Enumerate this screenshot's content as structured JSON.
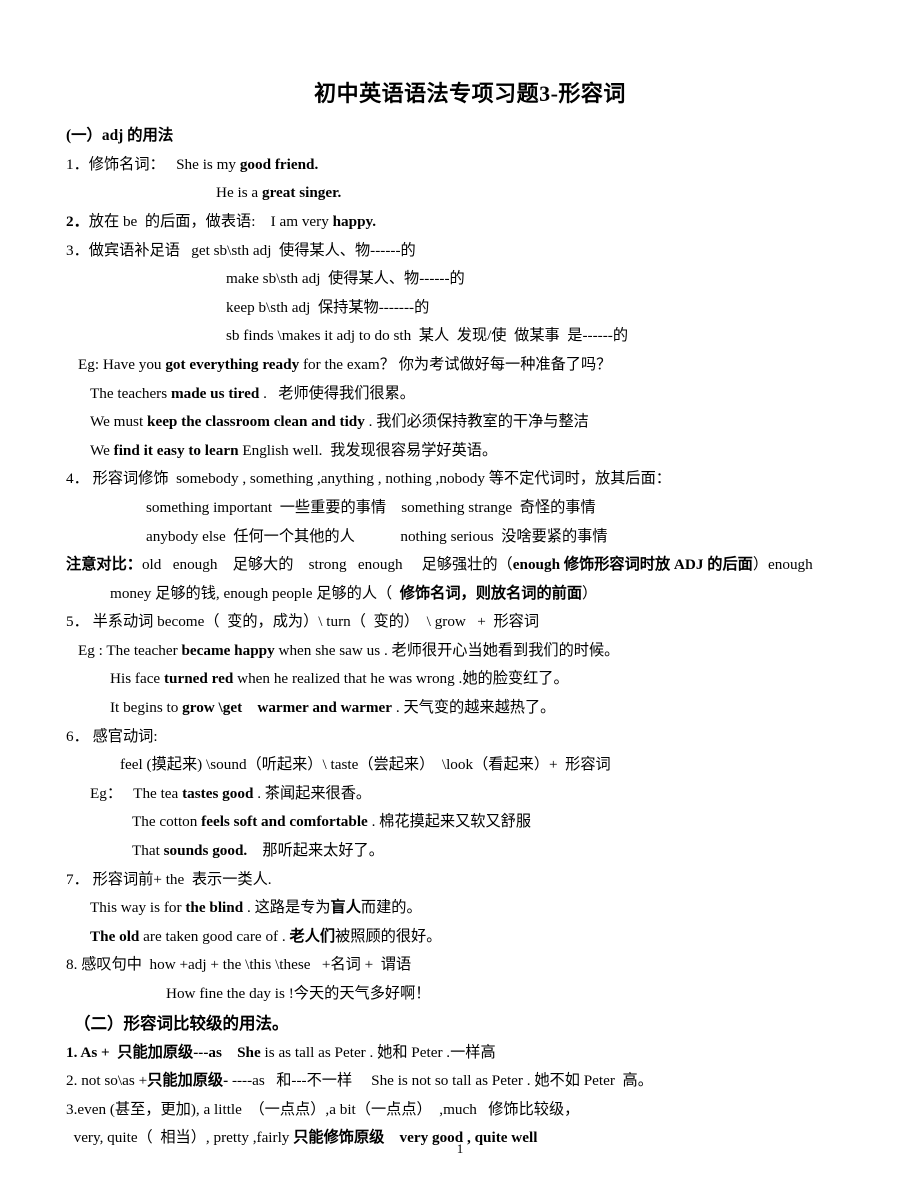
{
  "document": {
    "title": "初中英语语法专项习题3-形容词",
    "page_number": "1"
  },
  "section_one": {
    "heading": "(一）adj 的用法",
    "items": [
      {
        "number": "1．",
        "label": "修饰名词：",
        "example_plain": "   She is my ",
        "example_bold": "good friend."
      },
      {
        "cont_plain": "He is a ",
        "cont_bold": "great singer."
      },
      {
        "number": "2．",
        "label": "放在 be  的后面，做表语:",
        "example_plain": "    I am very ",
        "example_bold": "happy."
      },
      {
        "number": "3．",
        "label": "做宾语补足语",
        "example_plain": "   get sb\\sth adj  使得某人、物------的"
      }
    ],
    "patterns": [
      "make sb\\sth adj  使得某人、物------的",
      "keep b\\sth adj  保持某物-------的",
      "sb finds \\makes it adj to do sth  某人  发现/使  做某事  是------的"
    ],
    "examples": [
      {
        "pre": "Eg: Have you ",
        "bold": "got everything ready",
        "post": " for the exam？ 你为考试做好每一种准备了吗？"
      },
      {
        "pre": "The teachers ",
        "bold": "made us tired",
        "post": " .   老师使得我们很累。"
      },
      {
        "pre": "We must ",
        "bold": "keep the classroom clean and tidy",
        "post": " . 我们必须保持教室的干净与整洁"
      },
      {
        "pre": "We ",
        "bold": "find it easy to learn",
        "post": " English well.  我发现很容易学好英语。"
      }
    ],
    "item4": {
      "number": "4．",
      "text": " 形容词修饰  somebody , something ,anything , nothing ,nobody 等不定代词时，放其后面："
    },
    "item4_examples": [
      "something important  一些重要的事情    something strange  奇怪的事情",
      "anybody else  任何一个其他的人            nothing serious  没啥要紧的事情"
    ],
    "note": {
      "label": "注意对比：",
      "line1_a": "old   enough    足够大的    strong   enough     足够强壮的（",
      "line1_bold": "enough 修饰形容词时放 ADJ 的后面",
      "line1_b": "）enough",
      "line2_a": "money 足够的钱, enough people 足够的人（  ",
      "line2_bold": "修饰名词，则放名词的前面",
      "line2_b": "）"
    },
    "item5": {
      "number": "5．",
      "text": " 半系动词 become（  变的，成为）\\ turn（  变的）  \\ grow   +  形容词"
    },
    "item5_examples": [
      {
        "pre": "Eg : The teacher ",
        "bold": "became happy",
        "post": " when she saw us . 老师很开心当她看到我们的时候。"
      },
      {
        "pre": "His face ",
        "bold": "turned red",
        "post": " when he realized that he was wrong .她的脸变红了。"
      },
      {
        "pre": "It begins to ",
        "bold": "grow \\get    warmer and warmer",
        "post": " . 天气变的越来越热了。"
      }
    ],
    "item6": {
      "number": "6．",
      "text": " 感官动词:",
      "pattern": "feel (摸起来) \\sound（听起来）\\ taste（尝起来）  \\look（看起来）+  形容词"
    },
    "item6_examples": [
      {
        "pre": "Eg：   The tea ",
        "bold": "tastes good",
        "post": " . 茶闻起来很香。"
      },
      {
        "pre": "The cotton ",
        "bold": "feels soft and comfortable",
        "post": " . 棉花摸起来又软又舒服"
      },
      {
        "pre": "That ",
        "bold": "sounds good.",
        "post": "    那听起来太好了。"
      }
    ],
    "item7": {
      "number": "7．",
      "text": " 形容词前+ the  表示一类人."
    },
    "item7_examples": [
      {
        "pre": "This way is for ",
        "bold": "the blind",
        "post": " . 这路是专为",
        "post_bold": "盲人",
        "post2": "而建的。"
      },
      {
        "bold": "The old",
        "post": " are taken good care of . ",
        "post_bold": "老人们",
        "post2": "被照顾的很好。"
      }
    ],
    "item8": {
      "number": "8.",
      "text": " 感叹句中  how +adj + the \\this \\these   +名词 +  谓语",
      "example": "How fine the day is !今天的天气多好啊！"
    }
  },
  "section_two": {
    "heading": "（二）形容词比较级的用法。",
    "lines": [
      {
        "bold_lead": "1. As +  只能加原级---as",
        "mid_bold": "    She",
        "rest": " is as tall as Peter . 她和 Peter .一样高"
      },
      {
        "plain_lead": "2. not so\\as +",
        "bold_lead": "只能加原级-",
        "rest": " ----as   和---不一样     She is not so tall as Peter . 她不如 Peter  高。"
      },
      {
        "plain": "3.even (甚至，更加), a little  （一点点）,a bit（一点点）  ,much   修饰比较级，"
      },
      {
        "plain_lead": "  very, quite（  相当）, pretty ,fairly ",
        "bold_mid": "只能修饰原级",
        "bold_tail": "    very good , quite well"
      }
    ]
  }
}
